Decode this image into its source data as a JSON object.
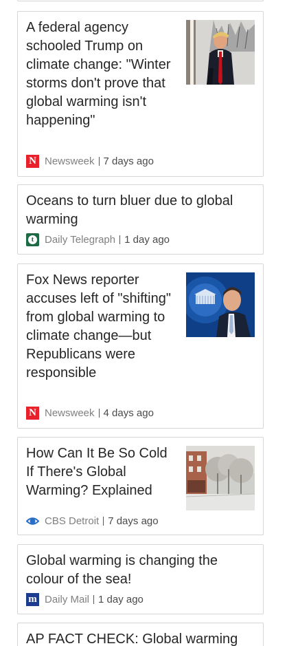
{
  "articles": [
    {
      "headline": "A federal agency schooled Trump on climate change: \"Winter storms don't prove that global warming isn't happening\"",
      "source": "Newsweek",
      "logo_glyph": "N",
      "time": "7 days ago",
      "has_thumbnail": true
    },
    {
      "headline": "Oceans to turn bluer due to global warming",
      "source": "Daily Telegraph",
      "logo_glyph": "t",
      "time": "1 day ago",
      "has_thumbnail": false
    },
    {
      "headline": "Fox News reporter accuses left of \"shifting\" from global warming to climate change—but Republicans were responsible",
      "source": "Newsweek",
      "logo_glyph": "N",
      "time": "4 days ago",
      "has_thumbnail": true
    },
    {
      "headline": "How Can It Be So Cold If There's Global Warming? Explained",
      "source": "CBS Detroit",
      "logo_glyph": "",
      "time": "7 days ago",
      "has_thumbnail": true
    },
    {
      "headline": "Global warming is changing the colour of the sea!",
      "source": "Daily Mail",
      "logo_glyph": "m",
      "time": "1 day ago",
      "has_thumbnail": false
    },
    {
      "headline": "AP FACT CHECK: Global warming",
      "source": "",
      "logo_glyph": "",
      "time": "",
      "has_thumbnail": false
    }
  ],
  "colors": {
    "card_border": "#d6d6d6",
    "headline_text": "#262626",
    "newsweek_red": "#e8202a",
    "telegraph_green": "#1d6a45",
    "dailymail_blue": "#1c3c8f",
    "cbs_blue": "#2b6fc4"
  },
  "icons": {
    "newsweek": "newsweek-logo-icon",
    "telegraph": "telegraph-logo-icon",
    "cbs": "cbs-eye-logo-icon",
    "dailymail": "dailymail-logo-icon"
  }
}
